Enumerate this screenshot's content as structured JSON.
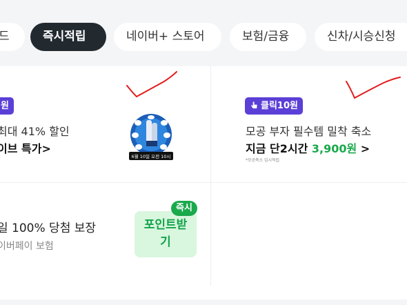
{
  "tabs": [
    {
      "label": "드"
    },
    {
      "label": "즉시적립"
    },
    {
      "label": "네이버+ 스토어"
    },
    {
      "label": "보험/금융"
    },
    {
      "label": "신차/시승신청"
    }
  ],
  "colors": {
    "accent_purple": "#5b3fd6",
    "accent_green": "#1aa94c",
    "active_tab": "#222a30"
  },
  "offers": {
    "left_top": {
      "badge": "원",
      "desc": "최대 41% 할인",
      "title": "이브 특가>",
      "thumb_caption": "6월 10일 오전 10시"
    },
    "right_top": {
      "badge": "클릭10원",
      "badge_icon": "click-hand-icon",
      "desc": "모공 부자 필수템 밀착 축소",
      "title_prefix": "지금 단2시간 ",
      "price": "3,900원",
      "title_suffix": " >",
      "fineprint": "*모공축소 임시적립"
    },
    "left_bottom": {
      "title": "일 100% 당첨 보장",
      "subtitle": "이버페이 보험",
      "tag": "즉시",
      "button_line1": "포인트받",
      "button_line2": "기"
    }
  }
}
